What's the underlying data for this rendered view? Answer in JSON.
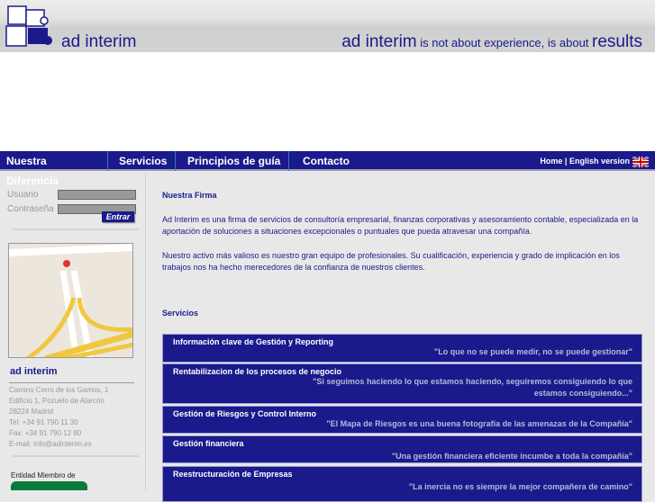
{
  "header": {
    "logo_text": "ad interim",
    "tagline_brand": "ad interim",
    "tagline_middle": " is not about experience, is about ",
    "tagline_end": "results"
  },
  "nav": {
    "items": [
      "Nuestra Diferencia",
      "Servicios",
      "Principios de guía",
      "Contacto"
    ],
    "home": "Home",
    "divider": "|",
    "english": "English version"
  },
  "login": {
    "user_label": "Usuario",
    "password_label": "Contraseña",
    "submit": "Entrar"
  },
  "company": {
    "name": "ad interim",
    "address": [
      "Camino Cerro de los Gamos, 1",
      "Edificio 1, Pozuelo de Alarcón",
      "28224 Madrid",
      "Tel: +34 91 790 11 30",
      "Fax: +34 91 790 12 80",
      "E-mail: info@adinterim.es"
    ],
    "member_label": "Entidad Miembro de"
  },
  "main": {
    "firma_title": "Nuestra Firma",
    "firma_p1": "Ad Interim es una firma de servicios de consultoría empresarial, finanzas corporativas y asesoramiento contable, especializada en la aportación de soluciones a situaciones excepcionales o puntuales que pueda atravesar una compañía.",
    "firma_p2": "Nuestro activo más valioso es nuestro gran equipo de profesionales. Su cualificación, experiencia y grado de implicación en los trabajos nos ha hecho merecedores de la confianza de nuestros clientes.",
    "servicios_title": "Servicios",
    "services": [
      {
        "title": "Información clave de Gestión y Reporting",
        "quote": "\"Lo que no se puede medir, no se puede gestionar\""
      },
      {
        "title": "Rentabilizacion de los procesos de negocio",
        "quote": "\"Si seguimos haciendo lo que estamos haciendo, seguiremos consiguiendo lo que estamos consiguiendo...\""
      },
      {
        "title": "Gestión de Riesgos y Control Interno",
        "quote": "\"El Mapa de Riesgos es una buena fotografía de las amenazas de la Compañía\""
      },
      {
        "title": "Gestión financiera",
        "quote": "\"Una gestión financiera eficiente incumbe a toda la compañía\""
      },
      {
        "title": "Reestructuración de Empresas",
        "quote": "\"La inercia no es siempre la mejor compañera de camino\""
      }
    ]
  }
}
